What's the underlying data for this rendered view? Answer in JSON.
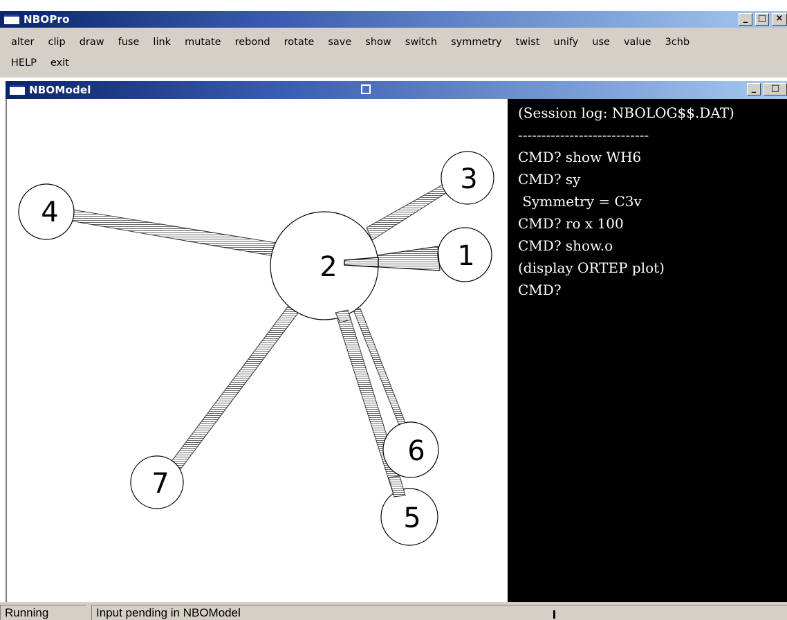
{
  "app": {
    "title": "NBOPro"
  },
  "menu": {
    "row1": [
      "alter",
      "clip",
      "draw",
      "fuse",
      "link",
      "mutate",
      "rebond",
      "rotate",
      "save",
      "show",
      "switch",
      "symmetry",
      "twist",
      "unify",
      "use",
      "value",
      "3chb"
    ],
    "row2": [
      "HELP",
      "exit"
    ]
  },
  "model_window": {
    "title": "NBOModel"
  },
  "window_controls": {
    "minimize": "_",
    "maximize": "□",
    "close": "×"
  },
  "atoms": [
    "1",
    "2",
    "3",
    "4",
    "5",
    "6",
    "7"
  ],
  "console": {
    "lines": [
      "(Session log: NBOLOG$$.DAT)",
      "----------------------------",
      "CMD? show WH6",
      "CMD? sy",
      " Symmetry = C3v",
      "CMD? ro x 100",
      "CMD? show.o",
      "(display ORTEP plot)",
      "CMD?"
    ]
  },
  "status": {
    "state": "Running",
    "message": "Input pending in NBOModel"
  }
}
